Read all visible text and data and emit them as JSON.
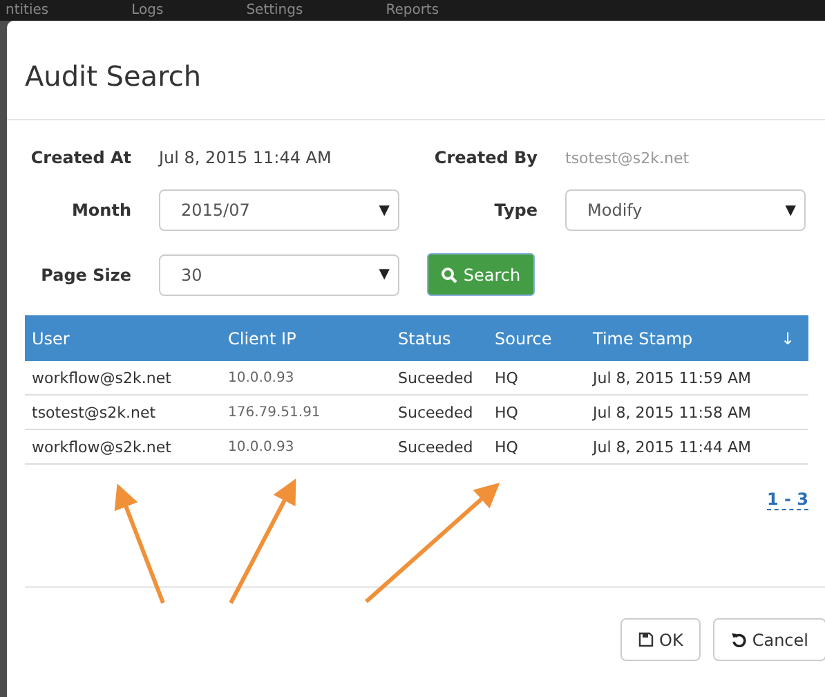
{
  "nav": {
    "items": [
      "ntities",
      "Logs",
      "Settings",
      "Reports"
    ]
  },
  "dialog": {
    "title": "Audit Search",
    "info": [
      {
        "label": "Created At",
        "value": "Jul 8, 2015 11:44 AM"
      },
      {
        "label": "Created By",
        "value": "tsotest@s2k.net"
      }
    ],
    "filters": [
      {
        "label": "Month",
        "value": "2015/07",
        "caret": "▼"
      },
      {
        "label": "Type",
        "value": "Modify",
        "caret": "▼"
      },
      {
        "label": "Page Size",
        "value": "30",
        "caret": "▼"
      }
    ],
    "search_button": "Search",
    "table": {
      "columns": [
        "User",
        "Client IP",
        "Status",
        "Source",
        "Time Stamp"
      ],
      "sort_icon": "↓",
      "rows": [
        {
          "cells": [
            "workflow@s2k.net",
            "10.0.0.93",
            "Suceeded",
            "HQ",
            "Jul 8, 2015 11:59 AM"
          ]
        },
        {
          "cells": [
            "tsotest@s2k.net",
            "176.79.51.91",
            "Suceeded",
            "HQ",
            "Jul 8, 2015 11:58 AM"
          ]
        },
        {
          "cells": [
            "workflow@s2k.net",
            "10.0.0.93",
            "Suceeded",
            "HQ",
            "Jul 8, 2015 11:44 AM"
          ]
        }
      ]
    },
    "pagination": "1 - 3",
    "buttons": [
      {
        "kind": "ok",
        "label": "OK"
      },
      {
        "kind": "cancel",
        "label": "Cancel"
      }
    ]
  }
}
